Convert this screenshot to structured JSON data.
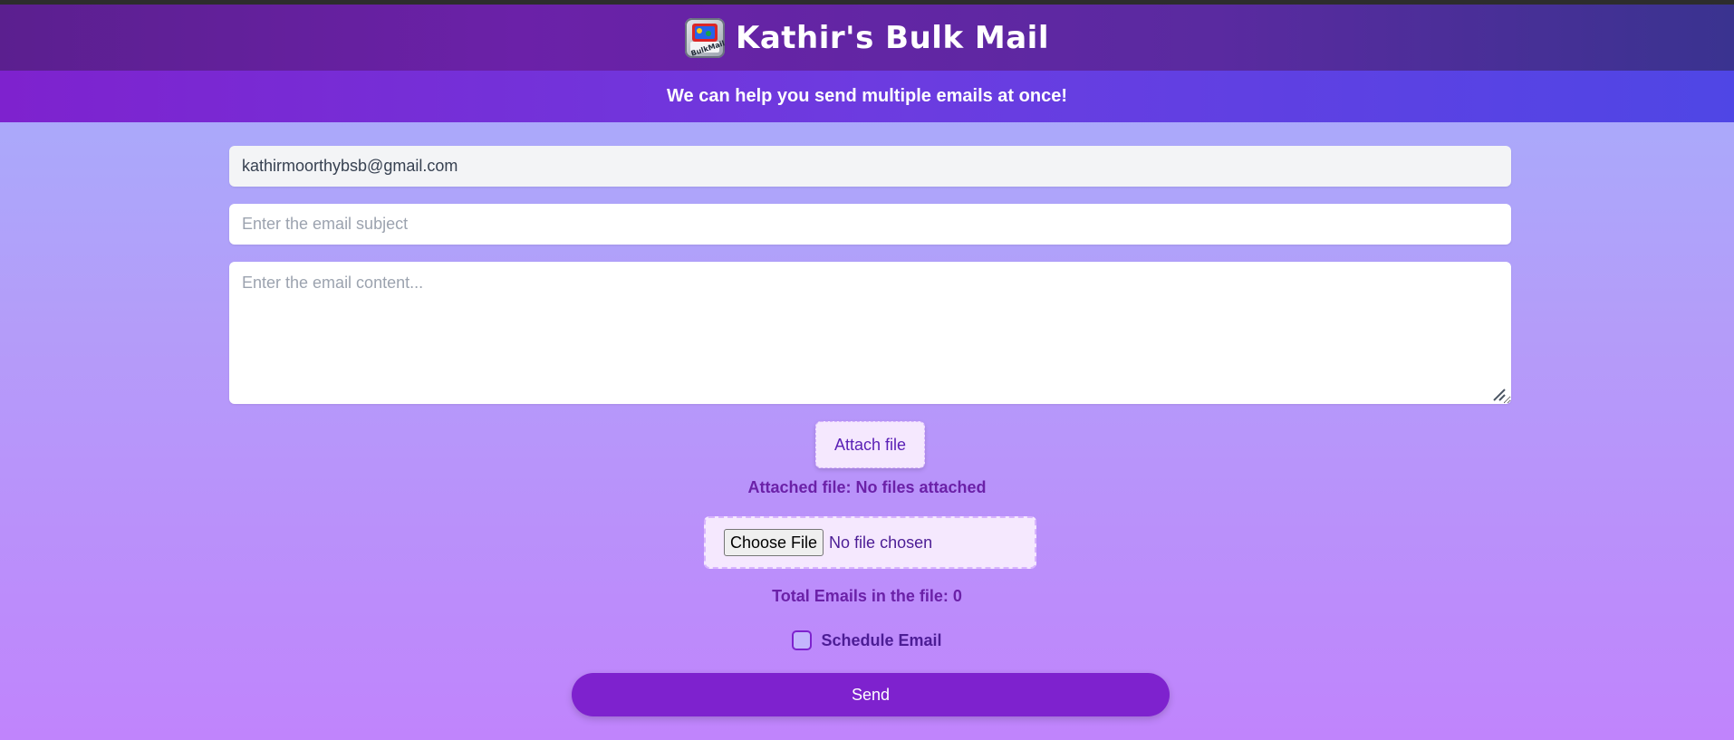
{
  "header": {
    "title": "Kathir's Bulk Mail",
    "logo_text": "BulkMail",
    "logo_icon": "mail-app-logo-icon"
  },
  "subtitle": "We can help you send multiple emails at once!",
  "form": {
    "sender_value": "kathirmoorthybsb@gmail.com",
    "subject_placeholder": "Enter the email subject",
    "content_placeholder": "Enter the email content..."
  },
  "attach": {
    "button_label": "Attach file",
    "attached_status": "Attached file: No files attached"
  },
  "file_input": {
    "choose_label": "Choose File",
    "status": "No file chosen"
  },
  "total_emails": "Total Emails in the file: 0",
  "schedule": {
    "label": "Schedule Email",
    "checked": false
  },
  "send_label": "Send",
  "colors": {
    "primary": "#7e22ce",
    "header": "#6b21a8",
    "subbar": "#4f46e5"
  }
}
